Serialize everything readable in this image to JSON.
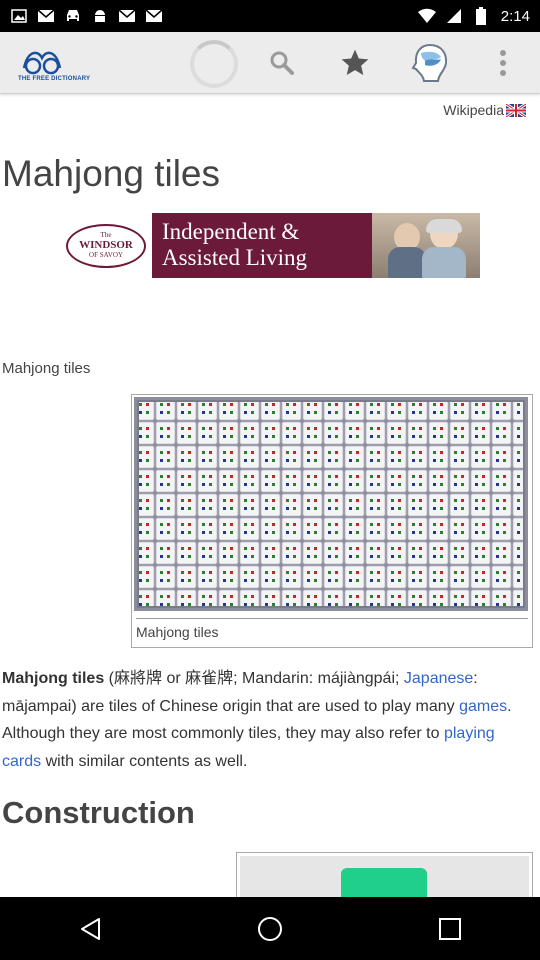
{
  "status_bar": {
    "time": "2:14",
    "left_icons": [
      "image-icon",
      "mail-icon",
      "car-icon",
      "android-icon",
      "mail-icon",
      "mail-icon"
    ],
    "right_icons": [
      "wifi-icon",
      "signal-icon",
      "battery-icon"
    ]
  },
  "toolbar": {
    "logo_text": "THE FREE DICTIONARY",
    "actions": [
      "search-icon",
      "star-icon",
      "brain-icon",
      "overflow-menu-icon"
    ]
  },
  "article": {
    "source_label": "Wikipedia",
    "title": "Mahjong tiles",
    "ad": {
      "logo_line1": "The",
      "logo_line2": "WINDSOR",
      "logo_line3": "OF SAVOY",
      "headline": "Independent & Assisted Living"
    },
    "image_section_label": "Mahjong tiles",
    "figure_caption": "Mahjong tiles",
    "paragraph": {
      "bold_term": "Mahjong tiles",
      "text1": " (麻將牌 or 麻雀牌; Mandarin: májiàngpái; ",
      "link1": "Japanese",
      "text2": ": mājampai) are tiles of Chinese origin that are used to play many ",
      "link2": "games",
      "text3": ". Although they are most commonly tiles, they may also refer to ",
      "link3": "playing cards",
      "text4": " with similar contents as well."
    },
    "section_heading": "Construction"
  },
  "nav_bar": {
    "buttons": [
      "back-icon",
      "home-icon",
      "recents-icon"
    ]
  },
  "colors": {
    "link": "#3366cc",
    "toolbar_bg": "#ececec",
    "ad_bg": "#6b1a3a",
    "tile_green": "#1fcf8a"
  }
}
